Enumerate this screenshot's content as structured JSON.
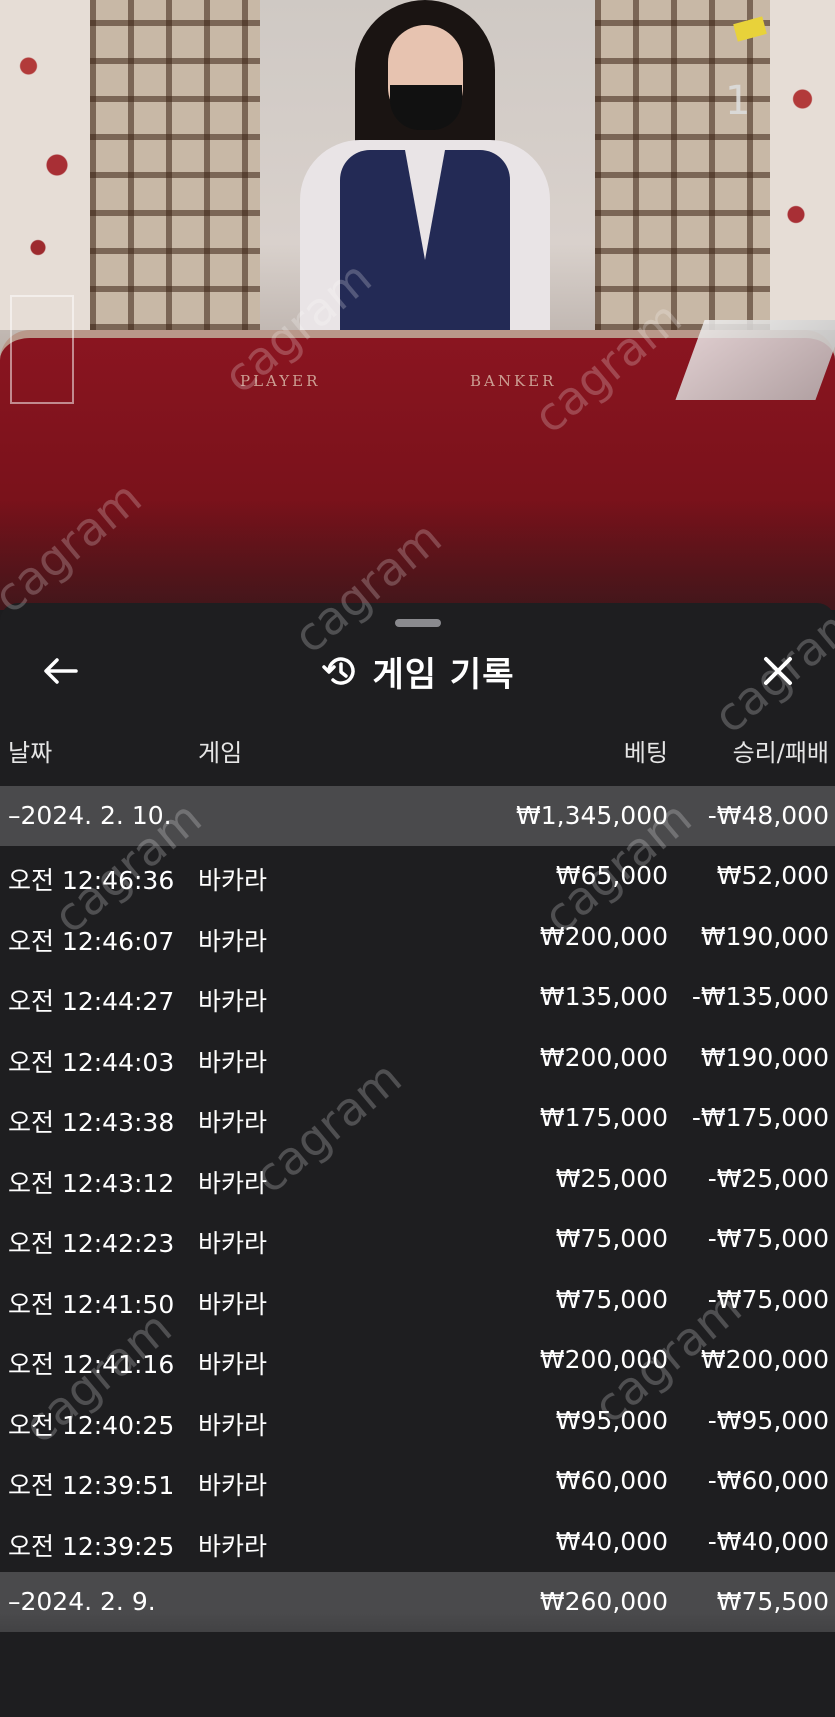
{
  "video": {
    "table_label_player": "PLAYER",
    "table_label_banker": "BANKER",
    "counter": "1"
  },
  "sheet": {
    "title": "게임 기록",
    "icons": {
      "back": "arrow-left-icon",
      "history": "history-icon",
      "close": "close-icon"
    },
    "columns": {
      "date": "날짜",
      "game": "게임",
      "bet": "베팅",
      "result": "승리/패배"
    },
    "groups": [
      {
        "date": "–2024. 2. 10.",
        "bet_total": "₩1,345,000",
        "result_total": "-₩48,000",
        "rows": [
          {
            "time": "오전 12:46:36",
            "game": "바카라",
            "bet": "₩65,000",
            "result": "₩52,000"
          },
          {
            "time": "오전 12:46:07",
            "game": "바카라",
            "bet": "₩200,000",
            "result": "₩190,000"
          },
          {
            "time": "오전 12:44:27",
            "game": "바카라",
            "bet": "₩135,000",
            "result": "-₩135,000"
          },
          {
            "time": "오전 12:44:03",
            "game": "바카라",
            "bet": "₩200,000",
            "result": "₩190,000"
          },
          {
            "time": "오전 12:43:38",
            "game": "바카라",
            "bet": "₩175,000",
            "result": "-₩175,000"
          },
          {
            "time": "오전 12:43:12",
            "game": "바카라",
            "bet": "₩25,000",
            "result": "-₩25,000"
          },
          {
            "time": "오전 12:42:23",
            "game": "바카라",
            "bet": "₩75,000",
            "result": "-₩75,000"
          },
          {
            "time": "오전 12:41:50",
            "game": "바카라",
            "bet": "₩75,000",
            "result": "-₩75,000"
          },
          {
            "time": "오전 12:41:16",
            "game": "바카라",
            "bet": "₩200,000",
            "result": "₩200,000"
          },
          {
            "time": "오전 12:40:25",
            "game": "바카라",
            "bet": "₩95,000",
            "result": "-₩95,000"
          },
          {
            "time": "오전 12:39:51",
            "game": "바카라",
            "bet": "₩60,000",
            "result": "-₩60,000"
          },
          {
            "time": "오전 12:39:25",
            "game": "바카라",
            "bet": "₩40,000",
            "result": "-₩40,000"
          }
        ]
      },
      {
        "date": "–2024. 2. 9.",
        "bet_total": "₩260,000",
        "result_total": "₩75,500",
        "rows": []
      }
    ]
  },
  "watermark": "cagram"
}
